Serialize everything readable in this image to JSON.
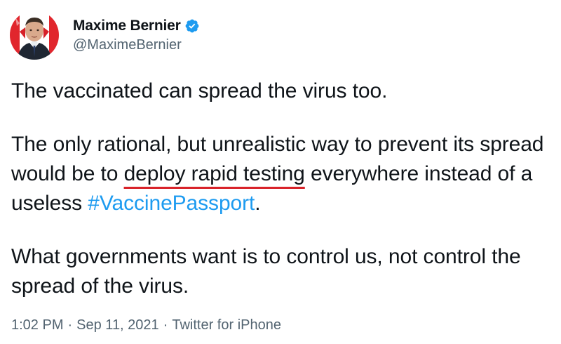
{
  "author": {
    "display_name": "Maxime Bernier",
    "handle": "@MaximeBernier",
    "verified_icon": "verified-badge-icon"
  },
  "tweet": {
    "paragraph_1": "The vaccinated can spread the virus too.",
    "paragraph_2_before": "The only rational, but unrealistic way to prevent its spread would be to ",
    "paragraph_2_highlight": "deploy rapid testing",
    "paragraph_2_middle": " everywhere instead of a useless ",
    "paragraph_2_hashtag": "#VaccinePassport",
    "paragraph_2_after": ".",
    "paragraph_3": "What governments want is to control us, not control the spread of the virus."
  },
  "meta": {
    "time": "1:02 PM",
    "separator": "·",
    "date": "Sep 11, 2021",
    "source": "Twitter for iPhone"
  },
  "colors": {
    "text": "#0f1419",
    "secondary": "#536471",
    "link": "#1d9bf0",
    "verified": "#1d9bf0",
    "highlight_underline": "#d9232a"
  }
}
